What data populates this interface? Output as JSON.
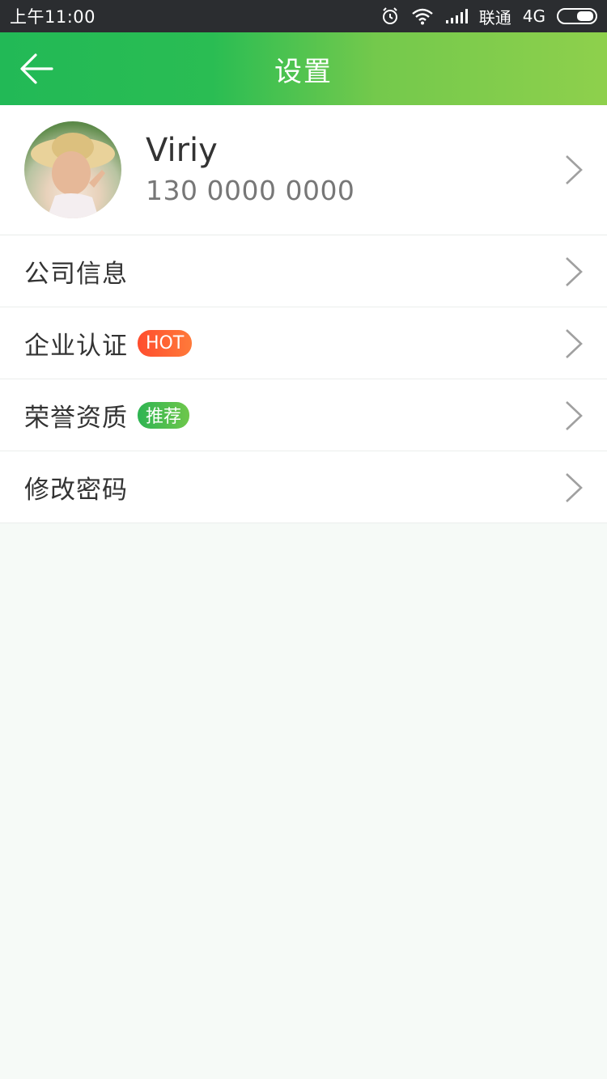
{
  "status_bar": {
    "time": "上午11:00",
    "carrier": "联通",
    "network": "4G",
    "icons": [
      "alarm-icon",
      "wifi-icon",
      "signal-icon",
      "battery-icon"
    ]
  },
  "nav": {
    "title": "设置",
    "back_icon": "arrow-left-icon"
  },
  "profile": {
    "name": "Viriy",
    "phone": "130 0000 0000"
  },
  "menu": {
    "items": [
      {
        "label": "公司信息"
      },
      {
        "label": "企业认证",
        "badge": "HOT"
      },
      {
        "label": "荣誉资质",
        "badge": "推荐"
      },
      {
        "label": "修改密码"
      }
    ]
  },
  "colors": {
    "nav_start": "#22b956",
    "nav_end": "#8ed04c",
    "hot_badge": "#ff5a32",
    "recommend_badge": "#3cb94f",
    "page_bg": "#f6faf7"
  }
}
